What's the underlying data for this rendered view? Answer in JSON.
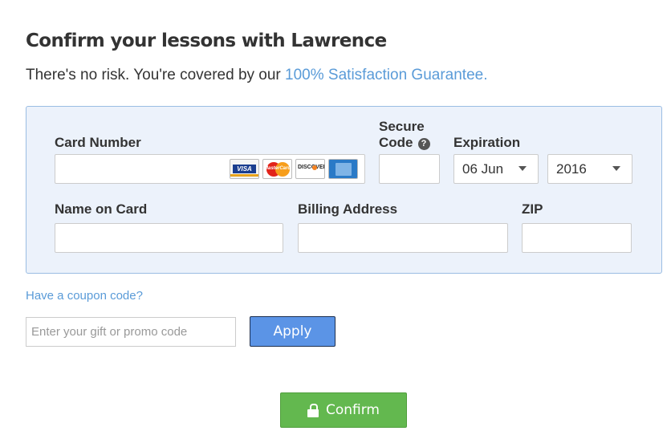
{
  "header": {
    "title": "Confirm your lessons with Lawrence",
    "subtitle_prefix": "There's no risk. You're covered by our",
    "guarantee_link": "100% Satisfaction Guarantee."
  },
  "payment": {
    "card_number_label": "Card Number",
    "card_number_value": "",
    "card_brands": [
      "VISA",
      "MasterCard",
      "DISCOVER",
      "American Express"
    ],
    "secure_code_label_line1": "Secure",
    "secure_code_label_line2": "Code",
    "secure_code_help": "?",
    "secure_code_value": "",
    "expiration_label": "Expiration",
    "expiration_month": "06 Jun",
    "expiration_year": "2016",
    "name_label": "Name on Card",
    "name_value": "",
    "billing_label": "Billing Address",
    "billing_value": "",
    "zip_label": "ZIP",
    "zip_value": ""
  },
  "coupon": {
    "link_text": "Have a coupon code?",
    "placeholder": "Enter your gift or promo code",
    "apply_label": "Apply"
  },
  "confirm": {
    "label": "Confirm"
  },
  "colors": {
    "link": "#5a9bd8",
    "panel_bg": "#ecf2fb",
    "panel_border": "#9bbde3",
    "apply_bg": "#5b94e6",
    "confirm_bg": "#63b84f"
  }
}
